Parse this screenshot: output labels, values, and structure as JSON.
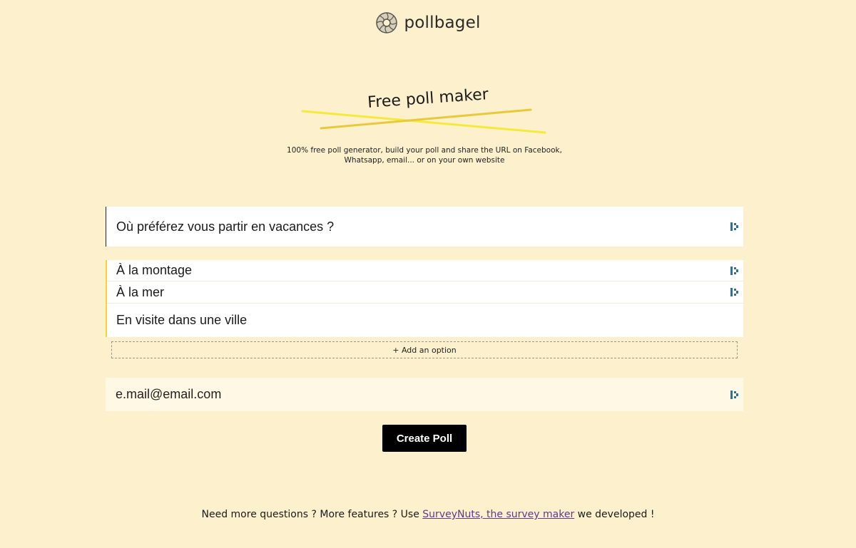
{
  "brand": {
    "name": "pollbagel",
    "logo_icon": "bagel-icon"
  },
  "hero": {
    "title": "Free poll maker",
    "subtitle": "100% free poll generator, build your poll and share the URL on Facebook, Whatsapp, email... or on your own website",
    "highlight_color": "#f5e03a"
  },
  "form": {
    "question": "Où préférez vous partir en vacances ?",
    "options": [
      "À la montage",
      "À la mer",
      "En visite dans une ville"
    ],
    "add_option_label": "+ Add an option",
    "email_value": "e.mail@email.com",
    "submit_label": "Create Poll",
    "field_extension_icon": "form-autofill-icon"
  },
  "footer": {
    "text_before": "Need more questions ? More features ? Use ",
    "link_text": "SurveyNuts, the survey maker",
    "text_after": " we developed !"
  },
  "colors": {
    "background": "#fdf0cc",
    "option_accent": "#f0d636",
    "button": "#000000",
    "link": "#5b3a8f"
  }
}
